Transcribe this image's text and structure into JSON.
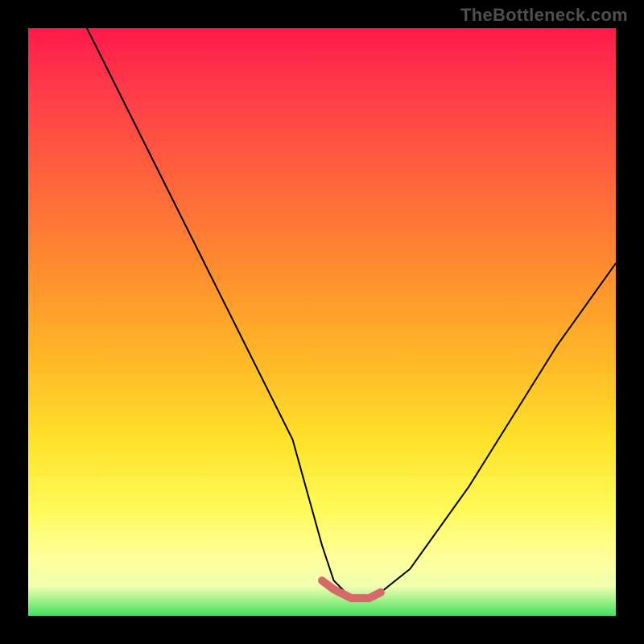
{
  "watermark_text": "TheBottleneck.com",
  "chart_data": {
    "type": "line",
    "title": "",
    "xlabel": "",
    "ylabel": "",
    "xlim": [
      0,
      100
    ],
    "ylim": [
      0,
      100
    ],
    "grid": false,
    "legend": false,
    "series": [
      {
        "name": "bottleneck-curve",
        "x": [
          10,
          15,
          20,
          25,
          30,
          35,
          40,
          45,
          50,
          52,
          55,
          58,
          60,
          65,
          70,
          75,
          80,
          85,
          90,
          95,
          100
        ],
        "values": [
          100,
          90,
          80,
          70,
          60,
          50,
          40,
          30,
          12,
          6,
          3,
          3,
          4,
          8,
          15,
          22,
          30,
          38,
          46,
          53,
          60
        ]
      },
      {
        "name": "highlight-bottom",
        "x": [
          50,
          52,
          55,
          58,
          60
        ],
        "values": [
          6,
          4.5,
          3,
          3,
          4
        ]
      }
    ],
    "gradient_colors": {
      "top": "#ff1a4a",
      "mid1": "#ff8a2f",
      "mid2": "#ffe12a",
      "bottom_band": "#ffff9a",
      "bottom": "#44e060"
    },
    "highlight_color": "#d66a6a"
  }
}
